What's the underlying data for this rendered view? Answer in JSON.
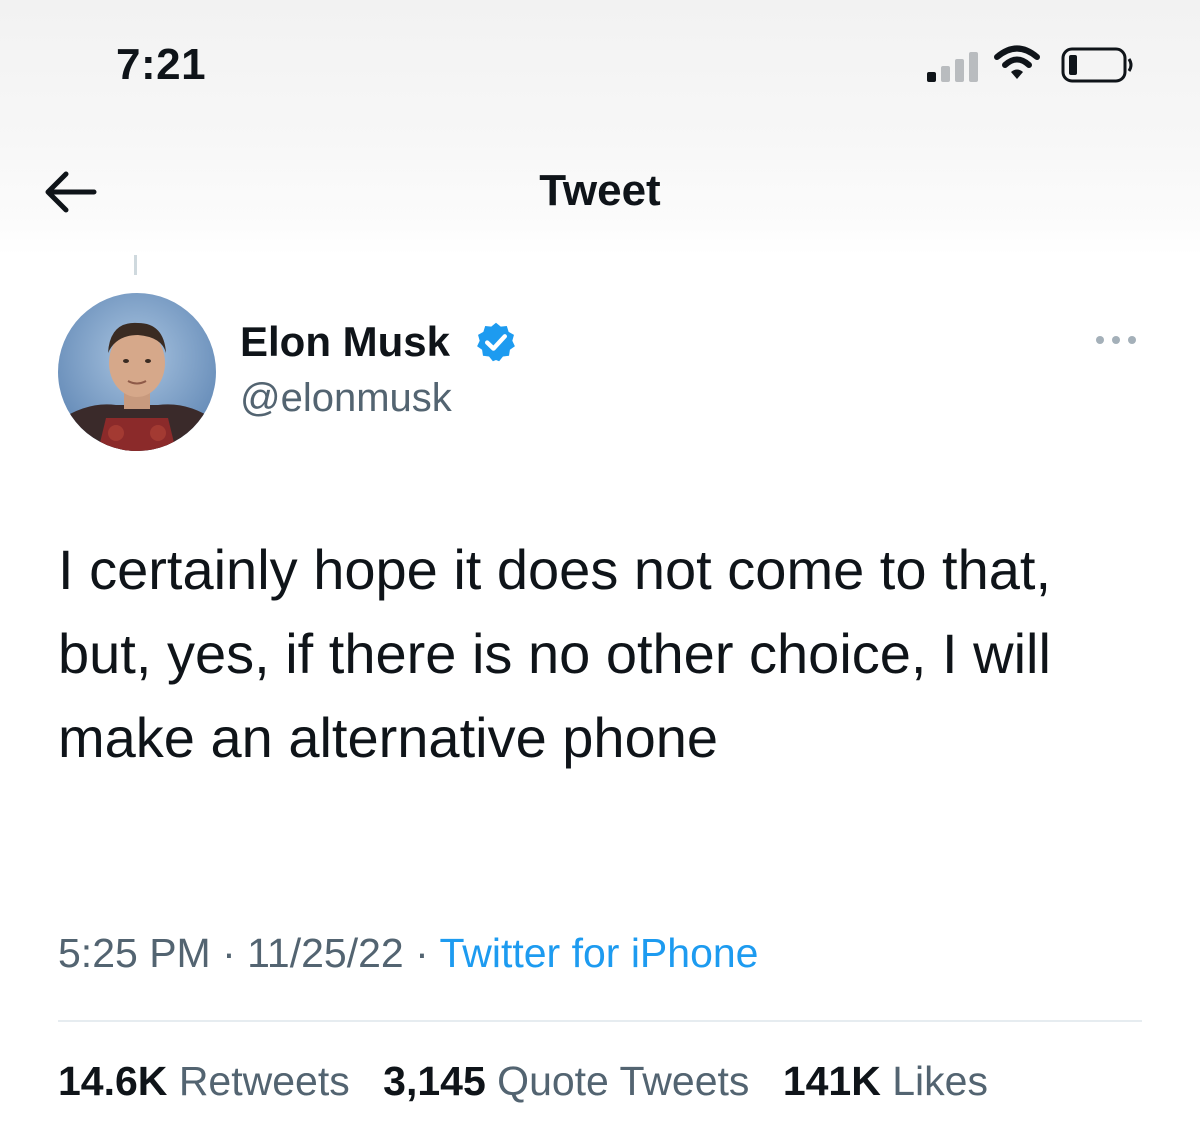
{
  "status_bar": {
    "time": "7:21"
  },
  "nav": {
    "title": "Tweet"
  },
  "tweet": {
    "display_name": "Elon Musk",
    "handle": "@elonmusk",
    "text": "I certainly hope it does not come to that, but, yes, if there is no other choice, I will make an alternative phone",
    "time": "5:25 PM",
    "date": "11/25/22",
    "separator": "·",
    "source": "Twitter for iPhone"
  },
  "stats": {
    "retweets_count": "14.6K",
    "retweets_label": "Retweets",
    "quote_count": "3,145",
    "quote_label": "Quote Tweets",
    "likes_count": "141K",
    "likes_label": "Likes"
  },
  "icons": {
    "back": "arrow-left-icon",
    "verified": "verified-badge-icon",
    "more": "more-horizontal-icon",
    "signal": "cellular-signal-icon",
    "wifi": "wifi-icon",
    "battery": "battery-icon"
  },
  "colors": {
    "accent": "#1d9bf0",
    "text_primary": "#0f1419",
    "text_secondary": "#536471"
  }
}
